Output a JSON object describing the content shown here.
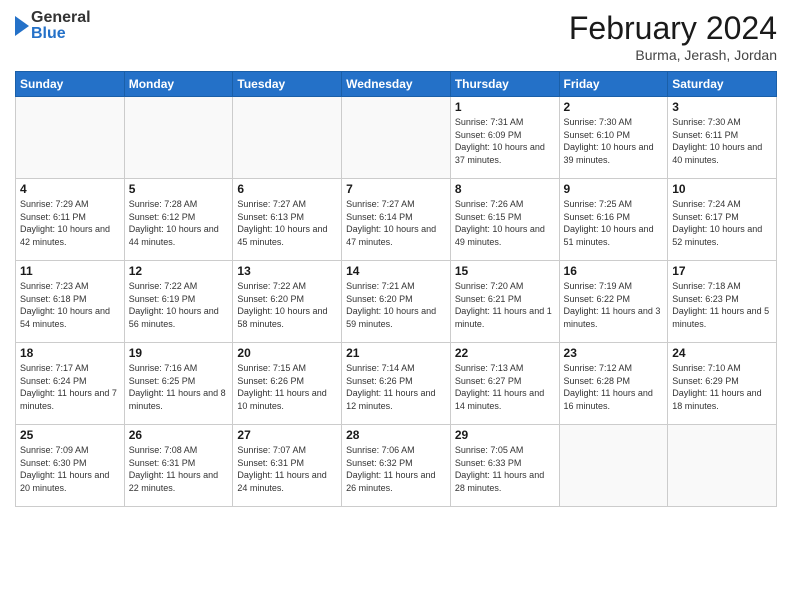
{
  "header": {
    "logo": {
      "general": "General",
      "blue": "Blue"
    },
    "title": "February 2024",
    "location": "Burma, Jerash, Jordan"
  },
  "weekdays": [
    "Sunday",
    "Monday",
    "Tuesday",
    "Wednesday",
    "Thursday",
    "Friday",
    "Saturday"
  ],
  "weeks": [
    [
      {
        "day": "",
        "info": ""
      },
      {
        "day": "",
        "info": ""
      },
      {
        "day": "",
        "info": ""
      },
      {
        "day": "",
        "info": ""
      },
      {
        "day": "1",
        "info": "Sunrise: 7:31 AM\nSunset: 6:09 PM\nDaylight: 10 hours and 37 minutes."
      },
      {
        "day": "2",
        "info": "Sunrise: 7:30 AM\nSunset: 6:10 PM\nDaylight: 10 hours and 39 minutes."
      },
      {
        "day": "3",
        "info": "Sunrise: 7:30 AM\nSunset: 6:11 PM\nDaylight: 10 hours and 40 minutes."
      }
    ],
    [
      {
        "day": "4",
        "info": "Sunrise: 7:29 AM\nSunset: 6:11 PM\nDaylight: 10 hours and 42 minutes."
      },
      {
        "day": "5",
        "info": "Sunrise: 7:28 AM\nSunset: 6:12 PM\nDaylight: 10 hours and 44 minutes."
      },
      {
        "day": "6",
        "info": "Sunrise: 7:27 AM\nSunset: 6:13 PM\nDaylight: 10 hours and 45 minutes."
      },
      {
        "day": "7",
        "info": "Sunrise: 7:27 AM\nSunset: 6:14 PM\nDaylight: 10 hours and 47 minutes."
      },
      {
        "day": "8",
        "info": "Sunrise: 7:26 AM\nSunset: 6:15 PM\nDaylight: 10 hours and 49 minutes."
      },
      {
        "day": "9",
        "info": "Sunrise: 7:25 AM\nSunset: 6:16 PM\nDaylight: 10 hours and 51 minutes."
      },
      {
        "day": "10",
        "info": "Sunrise: 7:24 AM\nSunset: 6:17 PM\nDaylight: 10 hours and 52 minutes."
      }
    ],
    [
      {
        "day": "11",
        "info": "Sunrise: 7:23 AM\nSunset: 6:18 PM\nDaylight: 10 hours and 54 minutes."
      },
      {
        "day": "12",
        "info": "Sunrise: 7:22 AM\nSunset: 6:19 PM\nDaylight: 10 hours and 56 minutes."
      },
      {
        "day": "13",
        "info": "Sunrise: 7:22 AM\nSunset: 6:20 PM\nDaylight: 10 hours and 58 minutes."
      },
      {
        "day": "14",
        "info": "Sunrise: 7:21 AM\nSunset: 6:20 PM\nDaylight: 10 hours and 59 minutes."
      },
      {
        "day": "15",
        "info": "Sunrise: 7:20 AM\nSunset: 6:21 PM\nDaylight: 11 hours and 1 minute."
      },
      {
        "day": "16",
        "info": "Sunrise: 7:19 AM\nSunset: 6:22 PM\nDaylight: 11 hours and 3 minutes."
      },
      {
        "day": "17",
        "info": "Sunrise: 7:18 AM\nSunset: 6:23 PM\nDaylight: 11 hours and 5 minutes."
      }
    ],
    [
      {
        "day": "18",
        "info": "Sunrise: 7:17 AM\nSunset: 6:24 PM\nDaylight: 11 hours and 7 minutes."
      },
      {
        "day": "19",
        "info": "Sunrise: 7:16 AM\nSunset: 6:25 PM\nDaylight: 11 hours and 8 minutes."
      },
      {
        "day": "20",
        "info": "Sunrise: 7:15 AM\nSunset: 6:26 PM\nDaylight: 11 hours and 10 minutes."
      },
      {
        "day": "21",
        "info": "Sunrise: 7:14 AM\nSunset: 6:26 PM\nDaylight: 11 hours and 12 minutes."
      },
      {
        "day": "22",
        "info": "Sunrise: 7:13 AM\nSunset: 6:27 PM\nDaylight: 11 hours and 14 minutes."
      },
      {
        "day": "23",
        "info": "Sunrise: 7:12 AM\nSunset: 6:28 PM\nDaylight: 11 hours and 16 minutes."
      },
      {
        "day": "24",
        "info": "Sunrise: 7:10 AM\nSunset: 6:29 PM\nDaylight: 11 hours and 18 minutes."
      }
    ],
    [
      {
        "day": "25",
        "info": "Sunrise: 7:09 AM\nSunset: 6:30 PM\nDaylight: 11 hours and 20 minutes."
      },
      {
        "day": "26",
        "info": "Sunrise: 7:08 AM\nSunset: 6:31 PM\nDaylight: 11 hours and 22 minutes."
      },
      {
        "day": "27",
        "info": "Sunrise: 7:07 AM\nSunset: 6:31 PM\nDaylight: 11 hours and 24 minutes."
      },
      {
        "day": "28",
        "info": "Sunrise: 7:06 AM\nSunset: 6:32 PM\nDaylight: 11 hours and 26 minutes."
      },
      {
        "day": "29",
        "info": "Sunrise: 7:05 AM\nSunset: 6:33 PM\nDaylight: 11 hours and 28 minutes."
      },
      {
        "day": "",
        "info": ""
      },
      {
        "day": "",
        "info": ""
      }
    ]
  ]
}
